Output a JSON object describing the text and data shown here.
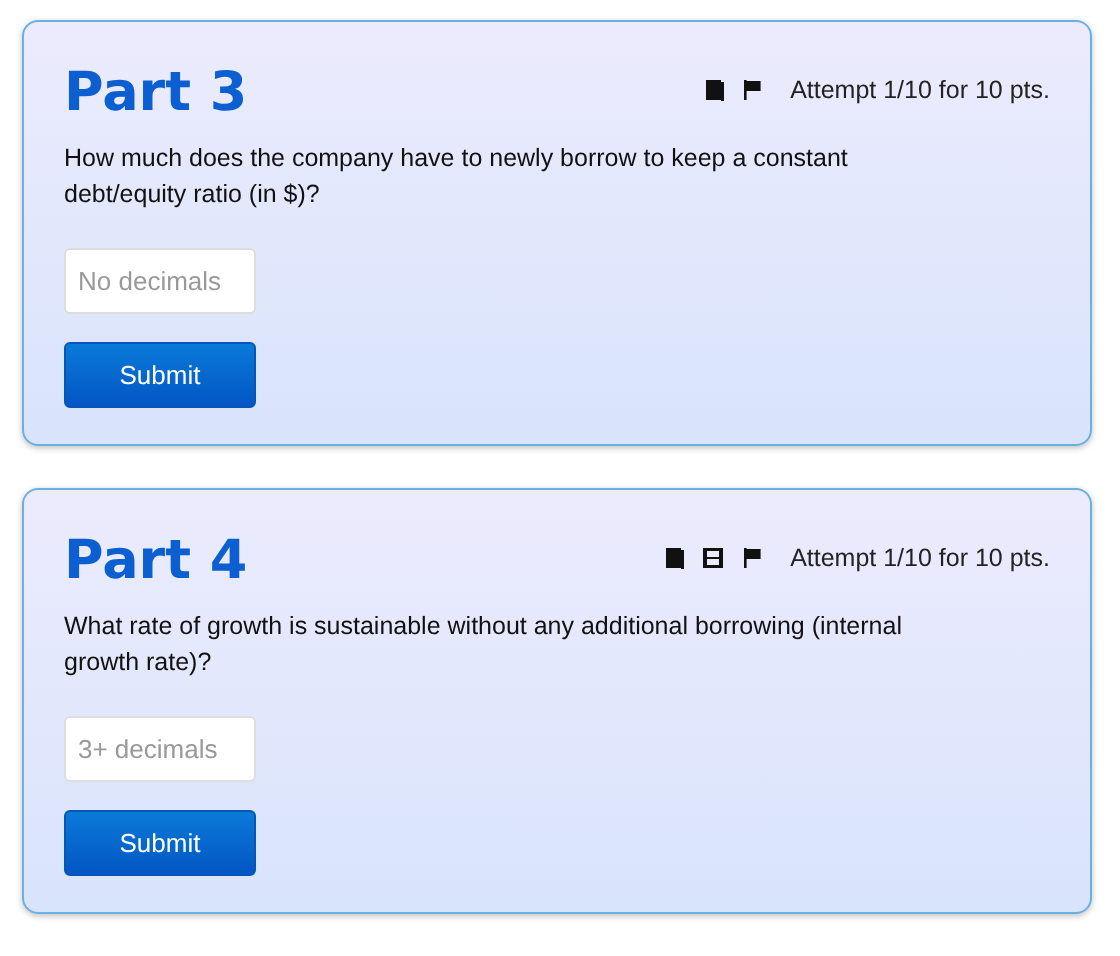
{
  "parts": [
    {
      "title": "Part 3",
      "icons": [
        {
          "kind": "book"
        },
        {
          "kind": "flag"
        }
      ],
      "attempt": "Attempt 1/10 for 10 pts.",
      "question": "How much does the company have to newly borrow to keep a constant debt/equity ratio (in $)?",
      "answer": {
        "placeholder": "No decimals"
      },
      "button": "Submit"
    },
    {
      "title": "Part 4",
      "icons": [
        {
          "kind": "book"
        },
        {
          "kind": "film"
        },
        {
          "kind": "flag"
        }
      ],
      "attempt": "Attempt 1/10 for 10 pts.",
      "question": "What rate of growth is sustainable without any additional borrowing (internal growth rate)?",
      "answer": {
        "placeholder": "3+ decimals"
      },
      "button": "Submit"
    }
  ]
}
